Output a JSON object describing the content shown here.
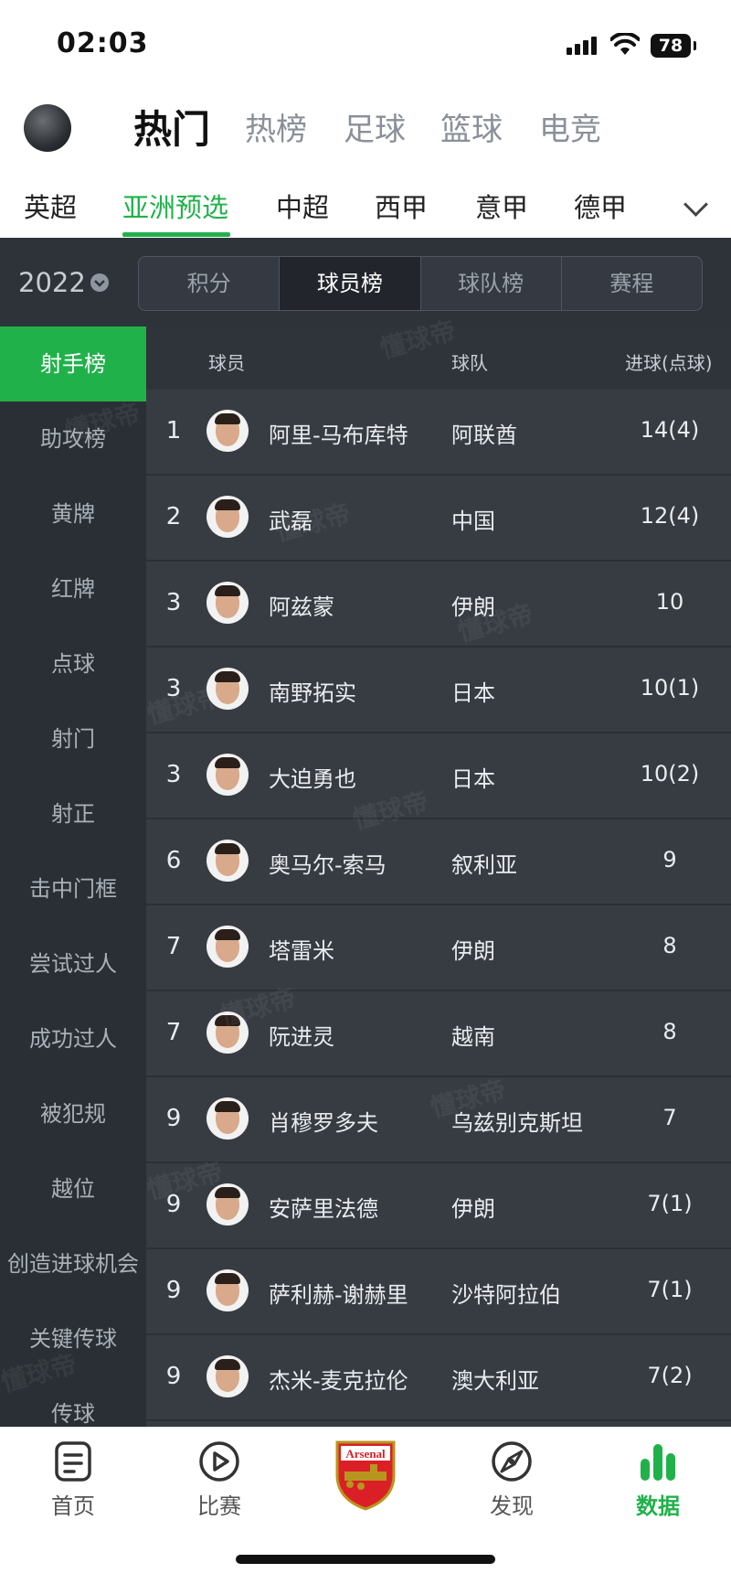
{
  "status_bar": {
    "time": "02:03",
    "battery": "78"
  },
  "top_nav": {
    "tabs": [
      "热门",
      "热榜",
      "足球",
      "篮球",
      "电竞"
    ],
    "active": "热门"
  },
  "leagues": {
    "items": [
      "英超",
      "亚洲预选",
      "中超",
      "西甲",
      "意甲",
      "德甲"
    ],
    "active": "亚洲预选"
  },
  "season": {
    "label": "2022"
  },
  "segments": {
    "items": [
      "积分",
      "球员榜",
      "球队榜",
      "赛程"
    ],
    "active": "球员榜"
  },
  "sidebar": {
    "items": [
      "射手榜",
      "助攻榜",
      "黄牌",
      "红牌",
      "点球",
      "射门",
      "射正",
      "击中门框",
      "尝试过人",
      "成功过人",
      "被犯规",
      "越位",
      "创造进球机会",
      "关键传球",
      "传球"
    ],
    "active": "射手榜"
  },
  "table": {
    "headers": {
      "player": "球员",
      "team": "球队",
      "goals": "进球(点球)"
    },
    "rows": [
      {
        "rank": "1",
        "player": "阿里-马布库特",
        "team": "阿联酋",
        "goals": "14(4)"
      },
      {
        "rank": "2",
        "player": "武磊",
        "team": "中国",
        "goals": "12(4)"
      },
      {
        "rank": "3",
        "player": "阿兹蒙",
        "team": "伊朗",
        "goals": "10"
      },
      {
        "rank": "3",
        "player": "南野拓实",
        "team": "日本",
        "goals": "10(1)"
      },
      {
        "rank": "3",
        "player": "大迫勇也",
        "team": "日本",
        "goals": "10(2)"
      },
      {
        "rank": "6",
        "player": "奥马尔-索马",
        "team": "叙利亚",
        "goals": "9"
      },
      {
        "rank": "7",
        "player": "塔雷米",
        "team": "伊朗",
        "goals": "8"
      },
      {
        "rank": "7",
        "player": "阮进灵",
        "team": "越南",
        "goals": "8"
      },
      {
        "rank": "9",
        "player": "肖穆罗多夫",
        "team": "乌兹别克斯坦",
        "goals": "7"
      },
      {
        "rank": "9",
        "player": "安萨里法德",
        "team": "伊朗",
        "goals": "7(1)"
      },
      {
        "rank": "9",
        "player": "萨利赫-谢赫里",
        "team": "沙特阿拉伯",
        "goals": "7(1)"
      },
      {
        "rank": "9",
        "player": "杰米-麦克拉伦",
        "team": "澳大利亚",
        "goals": "7(2)"
      }
    ]
  },
  "bottom_nav": {
    "items": [
      {
        "label": "首页",
        "icon": "document-icon"
      },
      {
        "label": "比赛",
        "icon": "play-icon"
      },
      {
        "label": "",
        "icon": "arsenal-crest-icon"
      },
      {
        "label": "发现",
        "icon": "discover-icon"
      },
      {
        "label": "数据",
        "icon": "bar-chart-icon"
      }
    ],
    "active": "数据",
    "crest_text": "Arsenal"
  },
  "watermark": "懂球帝",
  "colors": {
    "accent": "#21b14b",
    "dark_bg": "#2b2f36",
    "row_bg": "#373c43"
  }
}
